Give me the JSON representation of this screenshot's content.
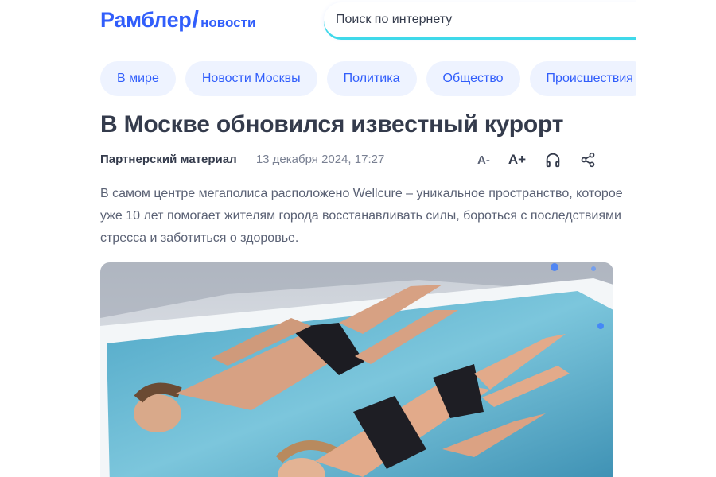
{
  "header": {
    "logo_main": "Рамблер",
    "logo_slash": "/",
    "logo_sub": "новости",
    "search_placeholder": "Поиск по интернету"
  },
  "categories": [
    "В мире",
    "Новости Москвы",
    "Политика",
    "Общество",
    "Происшествия"
  ],
  "article": {
    "title": "В Москве обновился известный курорт",
    "source": "Партнерский материал",
    "date": "13 декабря 2024, 17:27",
    "font_smaller": "A-",
    "font_larger": "A+",
    "lead": "В самом центре мегаполиса расположено Wellcure – уникальное пространство, которое уже 10 лет помогает жителям города восстанавливать силы, бороться с последствиями стресса и заботиться о здоровье.",
    "image_icon": "spa-photo"
  },
  "icons": {
    "listen": "headphones-icon",
    "share": "share-icon"
  },
  "colors": {
    "brand": "#315efb",
    "chip_bg": "#eef3ff",
    "text": "#343b4c",
    "muted": "#7a8193",
    "search_accent": "#3fd9ea"
  }
}
